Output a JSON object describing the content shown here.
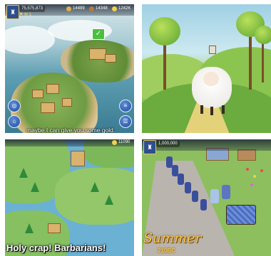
{
  "tiles": {
    "top_left": {
      "hud": {
        "power": "75,575,873",
        "resources": [
          "14489",
          "14348",
          "1242K"
        ],
        "badge_count": "1"
      },
      "check_label": "✓",
      "subtitle": "maybe I can give you some gold."
    },
    "top_right": {},
    "bottom_left": {
      "hud": {
        "resources": [
          "11090"
        ]
      },
      "subtitle": "Holy crap! Barbarians!"
    },
    "bottom_right": {
      "hud": {
        "power": "1,000,000"
      },
      "season": "Summer",
      "year": "210BC"
    }
  },
  "colors": {
    "hud_bg": "#1e2837",
    "subtitle_text": "#ffffff",
    "season_text": "#f7c94b",
    "check_green": "#4bbf3f",
    "button_blue": "#1f4d9a"
  },
  "icons": [
    "crest-icon",
    "food-icon",
    "wood-icon",
    "gold-icon",
    "check-icon",
    "menu-icon",
    "city-icon",
    "world-icon"
  ]
}
